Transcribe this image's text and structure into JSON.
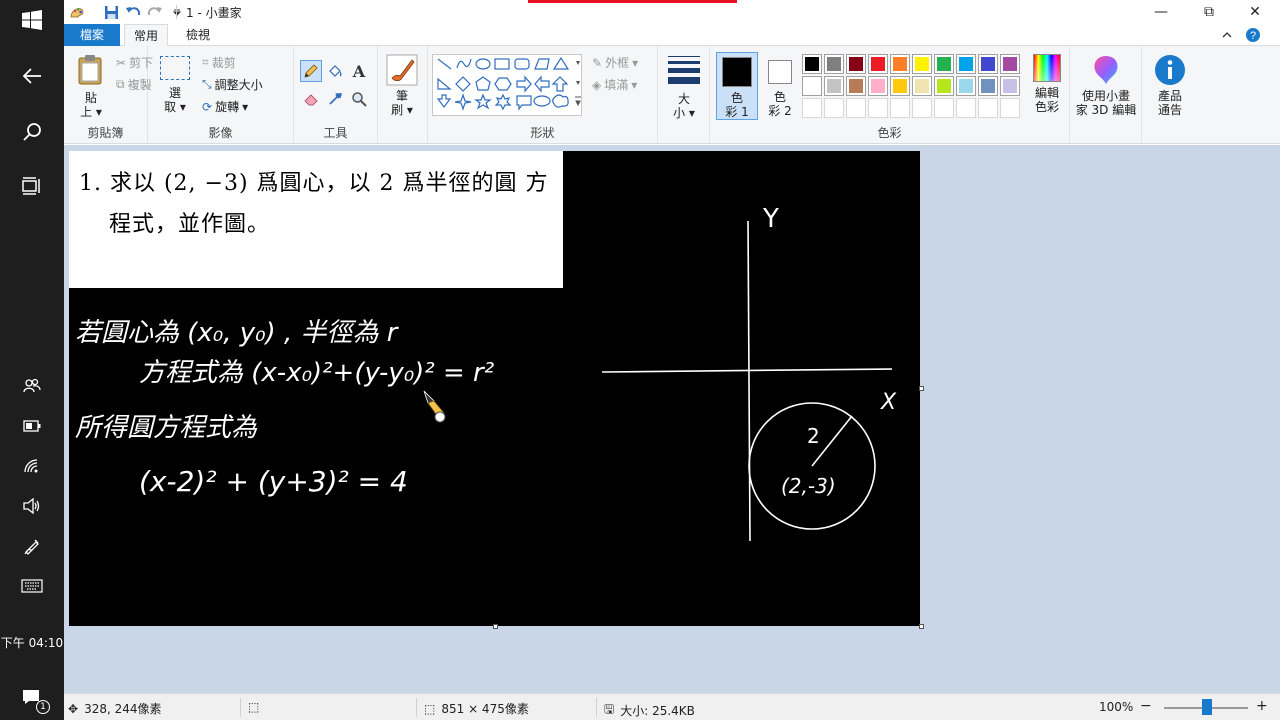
{
  "window": {
    "title": "1 - 小畫家",
    "minimize": "—",
    "maximize": "⧉",
    "close": "✕"
  },
  "tabs": {
    "file": "檔案",
    "home": "常用",
    "view": "檢視"
  },
  "clipboard": {
    "paste": "貼",
    "paste2": "上",
    "cut": "剪下",
    "copy": "複製",
    "label": "剪貼簿"
  },
  "image": {
    "select": "選",
    "select2": "取",
    "crop": "裁剪",
    "resize": "調整大小",
    "rotate": "旋轉",
    "label": "影像"
  },
  "tools": {
    "label": "工具",
    "text_icon": "A"
  },
  "brushes": {
    "line1": "筆",
    "line2": "刷"
  },
  "shapes": {
    "outline": "外框",
    "fill": "填滿",
    "label": "形狀"
  },
  "size": {
    "line1": "大",
    "line2": "小"
  },
  "colors": {
    "color1_line1": "色",
    "color1_line2": "彩 1",
    "color2_line1": "色",
    "color2_line2": "彩 2",
    "edit_line1": "編輯",
    "edit_line2": "色彩",
    "label": "色彩",
    "color1": "#000000",
    "color2": "#ffffff",
    "palette_row1": [
      "#000000",
      "#7f7f7f",
      "#880015",
      "#ed1c24",
      "#ff7f27",
      "#fff200",
      "#22b14c",
      "#00a2e8",
      "#3f48cc",
      "#a349a4"
    ],
    "palette_row2": [
      "#ffffff",
      "#c3c3c3",
      "#b97a57",
      "#ffaec9",
      "#ffc90e",
      "#efe4b0",
      "#b5e61d",
      "#99d9ea",
      "#7092be",
      "#c8bfe7"
    ]
  },
  "paint3d": {
    "line1": "使用小畫",
    "line2": "家 3D 編輯"
  },
  "product": {
    "line1": "產品",
    "line2": "通告"
  },
  "problem": {
    "line1": "1.  求以 (2,  −3) 爲圓心，以 2 爲半徑的圓 方",
    "line2": "程式，並作圖。"
  },
  "handwriting": {
    "line1": "若圓心為 (x₀, y₀) , 半徑為 r",
    "line2": "方程式為 (x-x₀)²+(y-y₀)² = r²",
    "line3": "所得圓方程式為",
    "line4": "(x-2)² + (y+3)² = 4",
    "axis_y": "Y",
    "axis_x": "X",
    "radius": "2",
    "center": "(2,-3)"
  },
  "taskbar": {
    "time": "下午 04:10",
    "notif_count": "1"
  },
  "status": {
    "cursor": "328, 244像素",
    "dims": "851 × 475像素",
    "size": "大小: 25.4KB",
    "zoom": "100%",
    "zoom_minus": "−",
    "zoom_plus": "+"
  }
}
